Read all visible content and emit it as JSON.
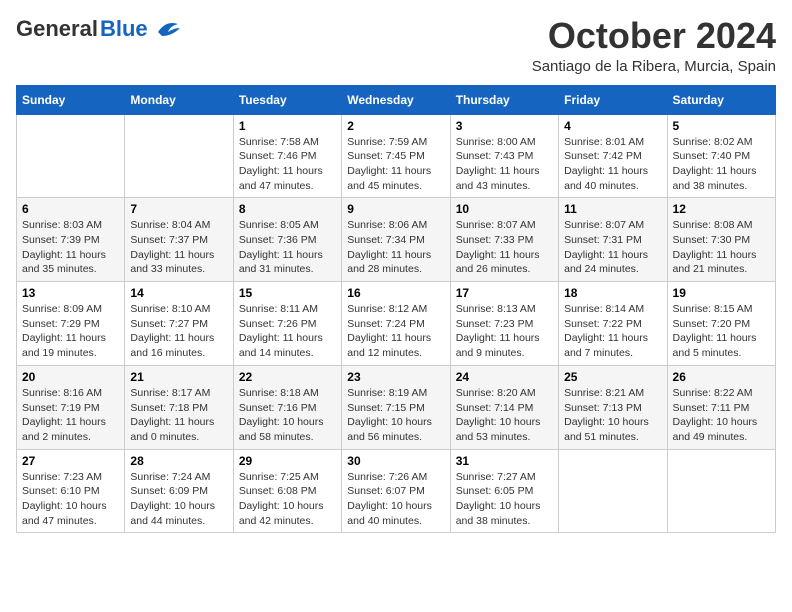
{
  "header": {
    "logo_general": "General",
    "logo_blue": "Blue",
    "month": "October 2024",
    "location": "Santiago de la Ribera, Murcia, Spain"
  },
  "weekdays": [
    "Sunday",
    "Monday",
    "Tuesday",
    "Wednesday",
    "Thursday",
    "Friday",
    "Saturday"
  ],
  "weeks": [
    [
      {
        "day": "",
        "info": ""
      },
      {
        "day": "",
        "info": ""
      },
      {
        "day": "1",
        "info": "Sunrise: 7:58 AM\nSunset: 7:46 PM\nDaylight: 11 hours and 47 minutes."
      },
      {
        "day": "2",
        "info": "Sunrise: 7:59 AM\nSunset: 7:45 PM\nDaylight: 11 hours and 45 minutes."
      },
      {
        "day": "3",
        "info": "Sunrise: 8:00 AM\nSunset: 7:43 PM\nDaylight: 11 hours and 43 minutes."
      },
      {
        "day": "4",
        "info": "Sunrise: 8:01 AM\nSunset: 7:42 PM\nDaylight: 11 hours and 40 minutes."
      },
      {
        "day": "5",
        "info": "Sunrise: 8:02 AM\nSunset: 7:40 PM\nDaylight: 11 hours and 38 minutes."
      }
    ],
    [
      {
        "day": "6",
        "info": "Sunrise: 8:03 AM\nSunset: 7:39 PM\nDaylight: 11 hours and 35 minutes."
      },
      {
        "day": "7",
        "info": "Sunrise: 8:04 AM\nSunset: 7:37 PM\nDaylight: 11 hours and 33 minutes."
      },
      {
        "day": "8",
        "info": "Sunrise: 8:05 AM\nSunset: 7:36 PM\nDaylight: 11 hours and 31 minutes."
      },
      {
        "day": "9",
        "info": "Sunrise: 8:06 AM\nSunset: 7:34 PM\nDaylight: 11 hours and 28 minutes."
      },
      {
        "day": "10",
        "info": "Sunrise: 8:07 AM\nSunset: 7:33 PM\nDaylight: 11 hours and 26 minutes."
      },
      {
        "day": "11",
        "info": "Sunrise: 8:07 AM\nSunset: 7:31 PM\nDaylight: 11 hours and 24 minutes."
      },
      {
        "day": "12",
        "info": "Sunrise: 8:08 AM\nSunset: 7:30 PM\nDaylight: 11 hours and 21 minutes."
      }
    ],
    [
      {
        "day": "13",
        "info": "Sunrise: 8:09 AM\nSunset: 7:29 PM\nDaylight: 11 hours and 19 minutes."
      },
      {
        "day": "14",
        "info": "Sunrise: 8:10 AM\nSunset: 7:27 PM\nDaylight: 11 hours and 16 minutes."
      },
      {
        "day": "15",
        "info": "Sunrise: 8:11 AM\nSunset: 7:26 PM\nDaylight: 11 hours and 14 minutes."
      },
      {
        "day": "16",
        "info": "Sunrise: 8:12 AM\nSunset: 7:24 PM\nDaylight: 11 hours and 12 minutes."
      },
      {
        "day": "17",
        "info": "Sunrise: 8:13 AM\nSunset: 7:23 PM\nDaylight: 11 hours and 9 minutes."
      },
      {
        "day": "18",
        "info": "Sunrise: 8:14 AM\nSunset: 7:22 PM\nDaylight: 11 hours and 7 minutes."
      },
      {
        "day": "19",
        "info": "Sunrise: 8:15 AM\nSunset: 7:20 PM\nDaylight: 11 hours and 5 minutes."
      }
    ],
    [
      {
        "day": "20",
        "info": "Sunrise: 8:16 AM\nSunset: 7:19 PM\nDaylight: 11 hours and 2 minutes."
      },
      {
        "day": "21",
        "info": "Sunrise: 8:17 AM\nSunset: 7:18 PM\nDaylight: 11 hours and 0 minutes."
      },
      {
        "day": "22",
        "info": "Sunrise: 8:18 AM\nSunset: 7:16 PM\nDaylight: 10 hours and 58 minutes."
      },
      {
        "day": "23",
        "info": "Sunrise: 8:19 AM\nSunset: 7:15 PM\nDaylight: 10 hours and 56 minutes."
      },
      {
        "day": "24",
        "info": "Sunrise: 8:20 AM\nSunset: 7:14 PM\nDaylight: 10 hours and 53 minutes."
      },
      {
        "day": "25",
        "info": "Sunrise: 8:21 AM\nSunset: 7:13 PM\nDaylight: 10 hours and 51 minutes."
      },
      {
        "day": "26",
        "info": "Sunrise: 8:22 AM\nSunset: 7:11 PM\nDaylight: 10 hours and 49 minutes."
      }
    ],
    [
      {
        "day": "27",
        "info": "Sunrise: 7:23 AM\nSunset: 6:10 PM\nDaylight: 10 hours and 47 minutes."
      },
      {
        "day": "28",
        "info": "Sunrise: 7:24 AM\nSunset: 6:09 PM\nDaylight: 10 hours and 44 minutes."
      },
      {
        "day": "29",
        "info": "Sunrise: 7:25 AM\nSunset: 6:08 PM\nDaylight: 10 hours and 42 minutes."
      },
      {
        "day": "30",
        "info": "Sunrise: 7:26 AM\nSunset: 6:07 PM\nDaylight: 10 hours and 40 minutes."
      },
      {
        "day": "31",
        "info": "Sunrise: 7:27 AM\nSunset: 6:05 PM\nDaylight: 10 hours and 38 minutes."
      },
      {
        "day": "",
        "info": ""
      },
      {
        "day": "",
        "info": ""
      }
    ]
  ]
}
